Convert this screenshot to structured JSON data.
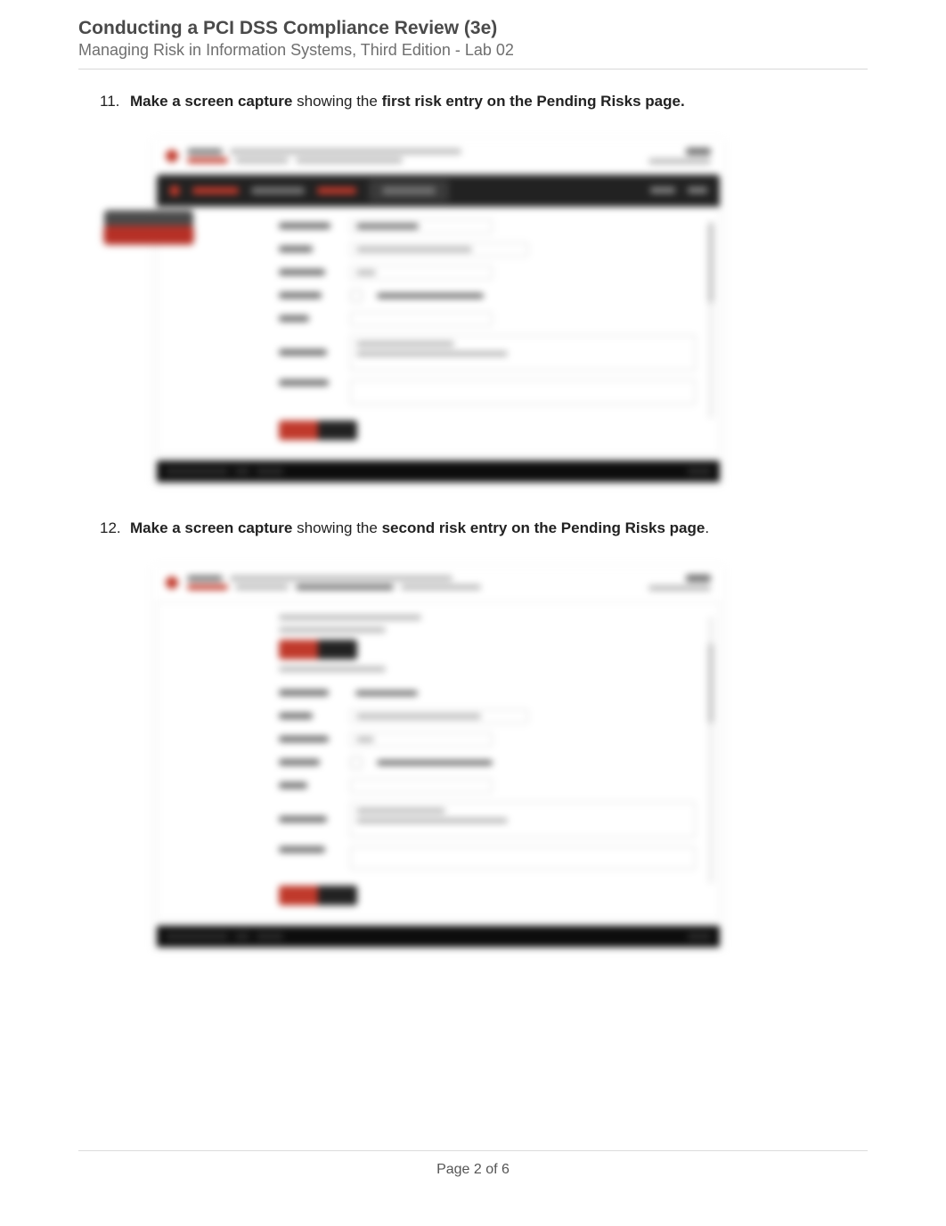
{
  "header": {
    "title": "Conducting a PCI DSS Compliance Review (3e)",
    "subtitle": "Managing Risk in Information Systems, Third Edition - Lab 02"
  },
  "instructions": [
    {
      "num": "11.",
      "bold1": "Make a screen capture",
      "mid": " showing the ",
      "bold2": "first risk entry on the Pending Risks page."
    },
    {
      "num": "12.",
      "bold1": "Make a screen capture",
      "mid": " showing the ",
      "bold2": "second risk entry on the Pending Risks page",
      "tail": "."
    }
  ],
  "footer": {
    "page_label": "Page 2 of 6"
  }
}
